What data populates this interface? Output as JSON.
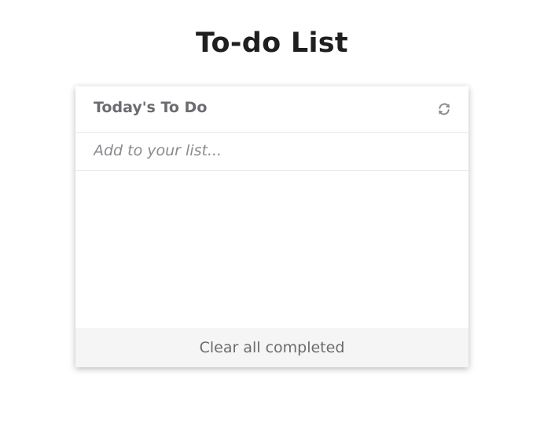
{
  "page": {
    "title": "To-do List"
  },
  "card": {
    "title": "Today's To Do",
    "refresh_icon": "refresh-icon",
    "input": {
      "placeholder": "Add to your list...",
      "value": ""
    },
    "items": [],
    "footer": {
      "clear_label": "Clear all completed"
    }
  },
  "colors": {
    "title_text": "#1f1f1f",
    "muted_text": "#6b6b70",
    "placeholder_text": "#8a8a8f",
    "footer_bg": "#f5f5f5",
    "divider": "#e8e8e8",
    "icon": "#8c8c8c"
  }
}
